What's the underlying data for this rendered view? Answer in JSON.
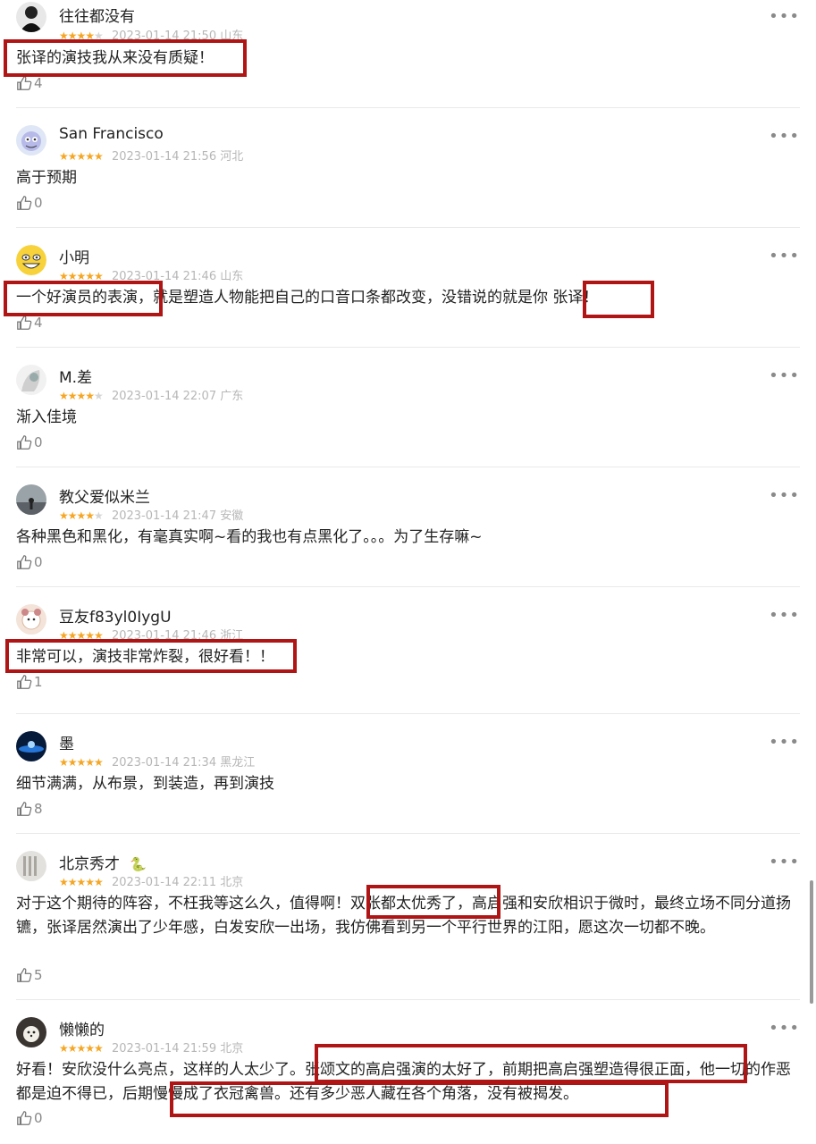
{
  "reviews": [
    {
      "username": "往往都没有",
      "rating": 4,
      "date": "2023-01-14 21:50",
      "location": "山东",
      "content": "张译的演技我从来没有质疑！",
      "likes": "4",
      "avatar": "avatar-dark"
    },
    {
      "username": "San Francisco",
      "rating": 5,
      "date": "2023-01-14 21:56",
      "location": "河北",
      "content": "高于预期",
      "likes": "0",
      "avatar": "avatar-cartoon"
    },
    {
      "username": "小明",
      "rating": 5,
      "date": "2023-01-14 21:46",
      "location": "山东",
      "content": "一个好演员的表演，就是塑造人物能把自己的口音口条都改变，没错说的就是你 张译！",
      "likes": "4",
      "avatar": "avatar-emoji"
    },
    {
      "username": "M.差",
      "rating": 4,
      "date": "2023-01-14 22:07",
      "location": "广东",
      "content": "渐入佳境",
      "likes": "0",
      "avatar": "avatar-anime"
    },
    {
      "username": "教父爱似米兰",
      "rating": 4,
      "date": "2023-01-14 21:47",
      "location": "安徽",
      "content": "各种黑色和黑化，有毫真实啊~看的我也有点黑化了。。。为了生存嘛~",
      "likes": "0",
      "avatar": "avatar-landscape"
    },
    {
      "username": "豆友f83yl0IygU",
      "rating": 5,
      "date": "2023-01-14 21:46",
      "location": "浙江",
      "content": "非常可以，演技非常炸裂，很好看！！",
      "likes": "1",
      "avatar": "avatar-bear"
    },
    {
      "username": "墨",
      "rating": 5,
      "date": "2023-01-14 21:34",
      "location": "黑龙江",
      "content": "细节满满，从布景，到装造，再到演技",
      "likes": "8",
      "avatar": "avatar-night"
    },
    {
      "username": "北京秀才",
      "rating": 5,
      "date": "2023-01-14 22:11",
      "location": "北京",
      "badge": "🐍",
      "content": "对于这个期待的阵容，不枉我等这么久，值得啊！双张都太优秀了，高启强和安欣相识于微时，最终立场不同分道扬镳，张译居然演出了少年感，白发安欣一出场，我仿佛看到另一个平行世界的江阳，愿这次一切都不晚。",
      "likes": "5",
      "avatar": "avatar-paper"
    },
    {
      "username": "懒懒的",
      "rating": 5,
      "date": "2023-01-14 21:59",
      "location": "北京",
      "content": "好看！安欣没什么亮点，这样的人太少了。张颂文的高启强演的太好了，前期把高启强塑造得很正面，他一切的作恶都是迫不得已，后期慢慢成了衣冠禽兽。还有多少恶人藏在各个角落，没有被揭发。",
      "likes": "0",
      "avatar": "avatar-dog"
    }
  ],
  "more_label": "•••",
  "colors": {
    "star": "#f5a623",
    "highlight_box": "#b01515",
    "meta": "#b7b7b7"
  }
}
